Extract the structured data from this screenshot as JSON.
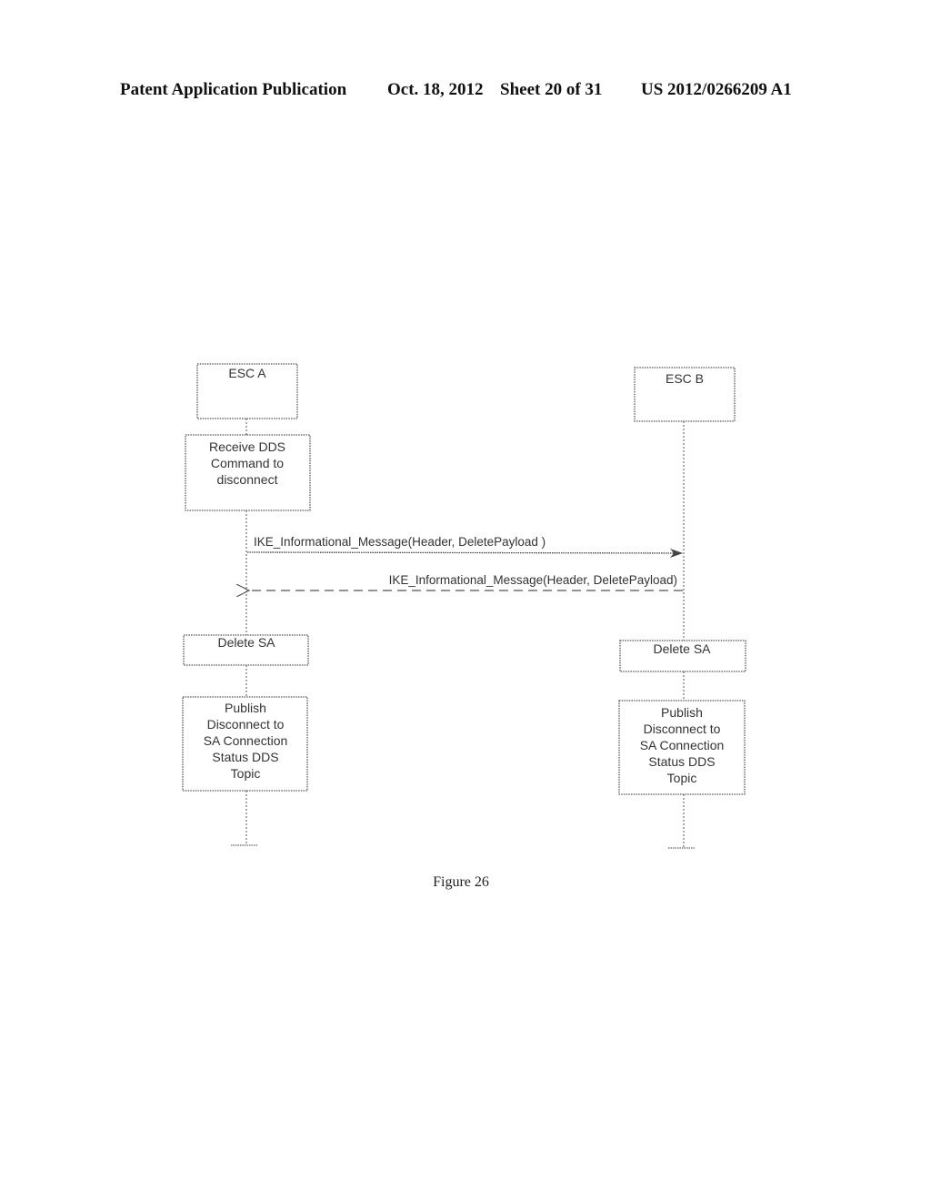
{
  "header": {
    "publication": "Patent Application Publication",
    "date": "Oct. 18, 2012",
    "sheet": "Sheet 20 of 31",
    "number": "US 2012/0266209 A1"
  },
  "diagram": {
    "type": "sequence",
    "participants": [
      {
        "id": "esc_a",
        "label": "ESC A"
      },
      {
        "id": "esc_b",
        "label": "ESC B"
      }
    ],
    "esc_a_steps": [
      {
        "lines": [
          "Receive DDS",
          "Command to",
          "disconnect"
        ]
      },
      {
        "lines": [
          "Delete SA"
        ]
      },
      {
        "lines": [
          "Publish",
          "Disconnect to",
          "SA Connection",
          "Status DDS",
          "Topic"
        ]
      }
    ],
    "esc_b_steps": [
      {
        "lines": [
          "Delete SA"
        ]
      },
      {
        "lines": [
          "Publish",
          "Disconnect to",
          "SA Connection",
          "Status DDS",
          "Topic"
        ]
      }
    ],
    "messages": [
      {
        "from": "ESC A",
        "to": "ESC B",
        "style": "solid",
        "label": "IKE_Informational_Message(Header, DeletePayload )"
      },
      {
        "from": "ESC B",
        "to": "ESC A",
        "style": "dashed-return",
        "label": "IKE_Informational_Message(Header, DeletePayload)"
      }
    ]
  },
  "caption": "Figure 26"
}
